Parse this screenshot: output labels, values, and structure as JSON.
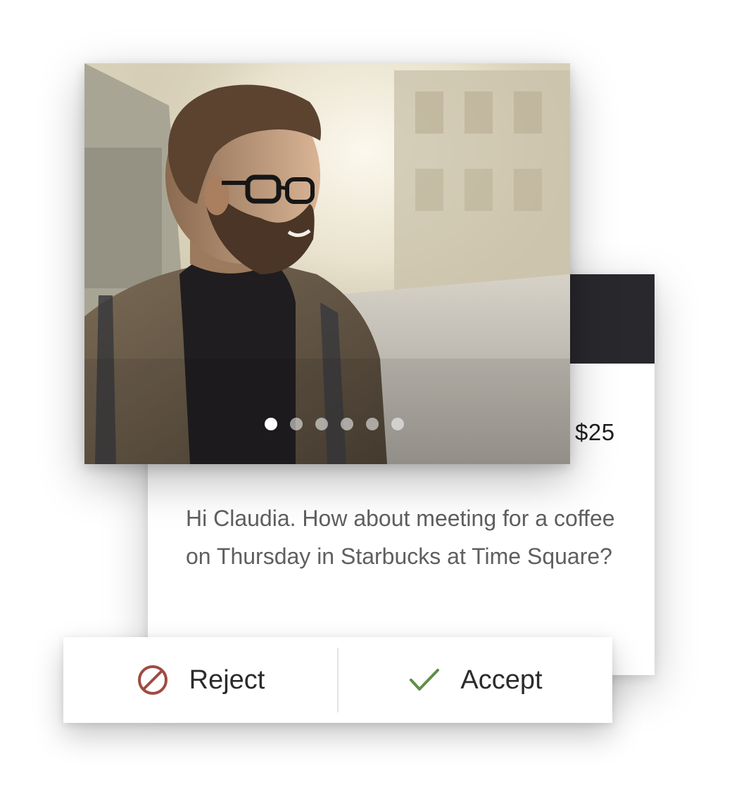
{
  "offer": {
    "price": "$25",
    "message": "Hi Claudia. How about meeting for a coffee on Thursday in Starbucks at Time Square?"
  },
  "gallery": {
    "photo_count": 6,
    "active_index": 0
  },
  "actions": {
    "reject_label": "Reject",
    "accept_label": "Accept"
  },
  "colors": {
    "header": "#29282d",
    "reject_icon": "#a04a42",
    "accept_icon": "#5f8f45"
  },
  "icons": {
    "reject": "block-icon",
    "accept": "check-icon"
  }
}
